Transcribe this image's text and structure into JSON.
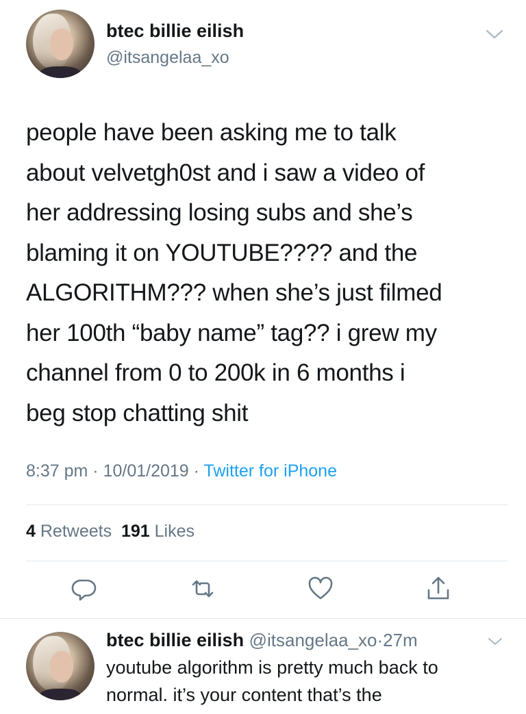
{
  "main_tweet": {
    "display_name": "btec billie eilish",
    "handle": "@itsangelaa_xo",
    "lines": [
      "people have been asking me to talk",
      "about velvetgh0st and i saw a video of",
      "her addressing losing subs and she’s",
      "blaming it on YOUTUBE???? and the",
      "ALGORITHM??? when she’s just filmed",
      "her 100th “baby name” tag?? i grew my",
      "channel from 0 to 200k in 6 months i",
      "beg stop chatting shit"
    ],
    "time": "8:37 pm",
    "separator": " · ",
    "date": "10/01/2019",
    "source": "Twitter for iPhone",
    "retweets_count": "4",
    "retweets_label": "Retweets",
    "likes_count": "191",
    "likes_label": "Likes"
  },
  "actions": {
    "reply": "reply-icon",
    "retweet": "retweet-icon",
    "like": "heart-icon",
    "share": "share-icon"
  },
  "reply_tweet": {
    "display_name": "btec billie eilish",
    "handle": "@itsangelaa_xo",
    "separator": "·",
    "age": "27m",
    "line1": "youtube algorithm is pretty much back to",
    "line2": "normal. it’s your content that’s the"
  },
  "colors": {
    "link": "#1da1f2",
    "secondary_text": "#657786",
    "divider": "#e1e8ed",
    "icon": "#657786"
  }
}
